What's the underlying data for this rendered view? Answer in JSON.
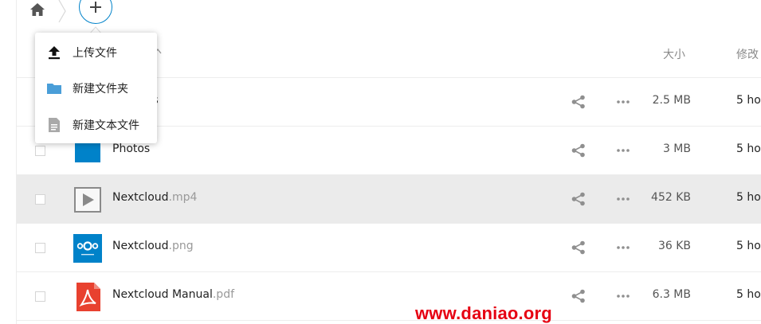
{
  "breadcrumb": {
    "home_icon": "home-icon",
    "new_button_icon": "plus-icon"
  },
  "new_menu": {
    "items": [
      {
        "label": "上传文件",
        "icon": "upload-icon"
      },
      {
        "label": "新建文件夹",
        "icon": "folder-icon"
      },
      {
        "label": "新建文本文件",
        "icon": "text-file-icon"
      }
    ]
  },
  "table": {
    "columns": {
      "size": "大小",
      "modified": "修改"
    },
    "rows": [
      {
        "name": "Documents",
        "visible_name": "nts",
        "ext": "",
        "size": "2.5 MB",
        "modified": "5 ho",
        "icon": "folder-icon",
        "highlighted": false
      },
      {
        "name": "Photos",
        "ext": "",
        "size": "3 MB",
        "modified": "5 ho",
        "icon": "folder-icon",
        "highlighted": false
      },
      {
        "name": "Nextcloud",
        "ext": ".mp4",
        "size": "452 KB",
        "modified": "5 ho",
        "icon": "video-file-icon",
        "highlighted": true
      },
      {
        "name": "Nextcloud",
        "ext": ".png",
        "size": "36 KB",
        "modified": "5 ho",
        "icon": "nextcloud-logo-icon",
        "highlighted": false
      },
      {
        "name": "Nextcloud Manual",
        "ext": ".pdf",
        "size": "6.3 MB",
        "modified": "5 ho",
        "icon": "pdf-file-icon",
        "highlighted": false
      }
    ]
  },
  "watermark": "www.daniao.org",
  "colors": {
    "accent": "#0082c9",
    "highlight_row": "#ebebeb",
    "pdf_red": "#e8412f",
    "watermark": "#e60012"
  }
}
